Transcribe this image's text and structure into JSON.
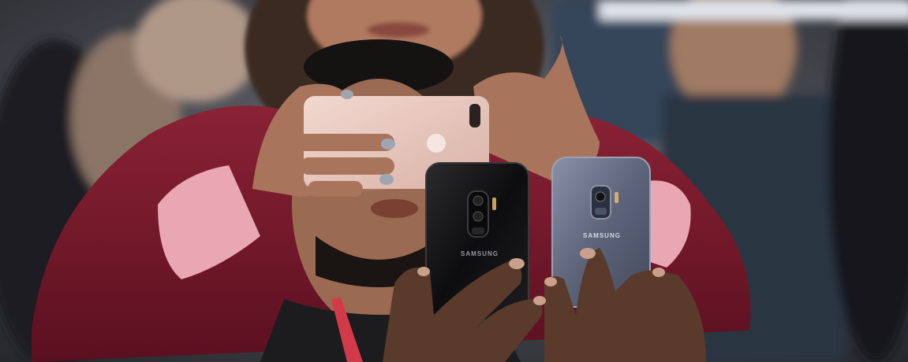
{
  "scene": {
    "phones": [
      {
        "name": "rose-gold-phone",
        "brand": "",
        "color": "#e8c8bf"
      },
      {
        "name": "black-samsung-phone",
        "brand": "SAMSUNG",
        "color": "#151515"
      },
      {
        "name": "blue-samsung-phone",
        "brand": "SAMSUNG",
        "color": "#6c7388"
      }
    ],
    "colors": {
      "background": "#4b4f57",
      "maroon_sweater": "#7a1a2c",
      "pink_sleeve": "#e9a7b4",
      "skin": "#9a6a52",
      "dark_skin": "#5a3a2a",
      "lanyard": "#d23a4a"
    }
  }
}
